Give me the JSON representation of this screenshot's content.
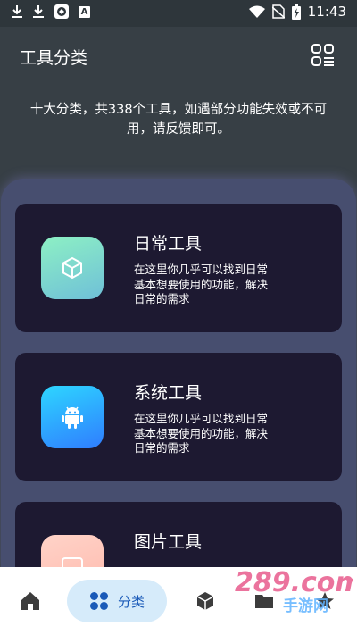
{
  "status_bar": {
    "time": "11:43",
    "left_icons": [
      "download-icon",
      "download-icon",
      "app-notification-icon",
      "a-icon"
    ],
    "right_icons": [
      "wifi-icon",
      "no-sim-icon",
      "battery-charging-icon"
    ],
    "a_label": "A"
  },
  "header": {
    "title": "工具分类",
    "grid_icon": "grid-view-icon"
  },
  "intro": {
    "text": "十大分类，共338个工具，如遇部分功能失效或不可用，请反馈即可。"
  },
  "categories": [
    {
      "title": "日常工具",
      "description": "在这里你几乎可以找到日常基本想要使用的功能，解决日常的需求",
      "icon": "cube-icon",
      "gradient": [
        "#8df0c4",
        "#6fc0d8"
      ]
    },
    {
      "title": "系统工具",
      "description": "在这里你几乎可以找到日常基本想要使用的功能，解决日常的需求",
      "icon": "android-icon",
      "gradient": [
        "#2ed6ff",
        "#2f7dff"
      ]
    },
    {
      "title": "图片工具",
      "description": "",
      "icon": "image-icon",
      "gradient": [
        "#ffd3c8",
        "#ffb9ad"
      ]
    }
  ],
  "bottom_nav": {
    "items": [
      {
        "icon": "home-icon",
        "label": ""
      },
      {
        "icon": "category-icon",
        "label": "分类"
      },
      {
        "icon": "cube-icon",
        "label": ""
      },
      {
        "icon": "folder-icon",
        "label": ""
      },
      {
        "icon": "star-icon",
        "label": ""
      }
    ],
    "active_index": 1
  },
  "watermark": {
    "text": "289.com",
    "subtext": "手游网"
  },
  "colors": {
    "background": "#373f45",
    "panel": "#474e6f",
    "card": "#1d1931",
    "nav_active_bg": "#d6ebfa",
    "nav_active_text": "#1a5ab8"
  }
}
